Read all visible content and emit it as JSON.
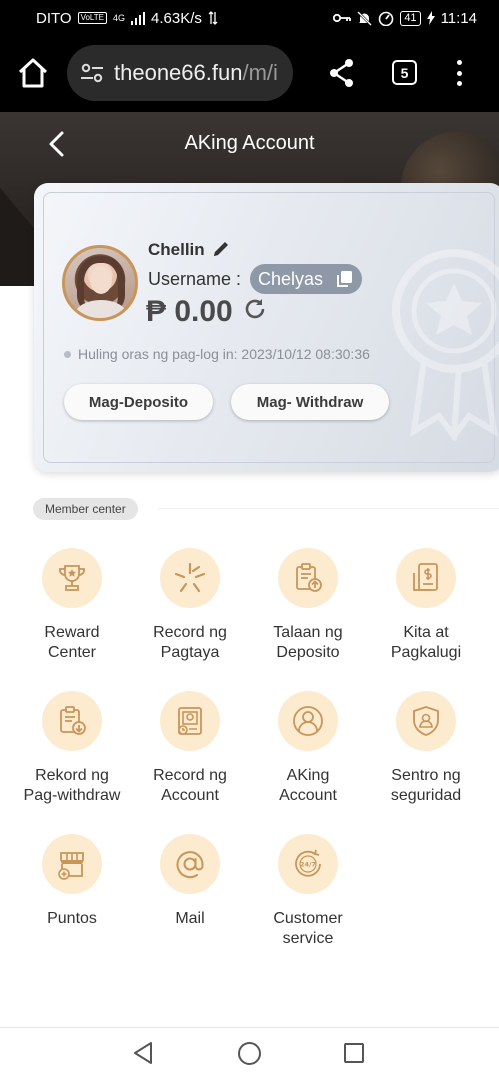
{
  "status_bar": {
    "carrier": "DITO",
    "volte": "VoLTE",
    "network": "4G",
    "speed": "4.63K/s",
    "battery": "41",
    "time": "11:14"
  },
  "browser": {
    "url_main": "theone66.fun",
    "url_rest": "/m/i",
    "tab_count": "5"
  },
  "header": {
    "title": "AKing Account"
  },
  "account": {
    "nickname": "Chellin",
    "username_label": "Username :",
    "username": "Chelyas",
    "balance": "₱ 0.00",
    "last_login": "Huling oras ng pag-log in: 2023/10/12 08:30:36",
    "deposit_button": "Mag-Deposito",
    "withdraw_button": "Mag- Withdraw"
  },
  "member_center": {
    "label": "Member center",
    "items": [
      {
        "label": "Reward\nCenter",
        "icon": "trophy-icon"
      },
      {
        "label": "Record ng\nPagtaya",
        "icon": "star-burst-icon"
      },
      {
        "label": "Talaan ng\nDeposito",
        "icon": "deposit-record-icon"
      },
      {
        "label": "Kita at\nPagkalugi",
        "icon": "profit-loss-icon"
      },
      {
        "label": "Rekord ng\nPag-withdraw",
        "icon": "withdraw-record-icon"
      },
      {
        "label": "Record ng\nAccount",
        "icon": "account-record-icon"
      },
      {
        "label": "AKing\nAccount",
        "icon": "user-icon"
      },
      {
        "label": "Sentro ng\nseguridad",
        "icon": "shield-user-icon"
      },
      {
        "label": "Puntos",
        "icon": "store-icon"
      },
      {
        "label": "Mail",
        "icon": "at-sign-icon"
      },
      {
        "label": "Customer\nservice",
        "icon": "24-7-icon"
      }
    ]
  },
  "theme": {
    "accent": "#c8955a",
    "icon_bg": "#fcebcf",
    "header_bg": "#2e2926"
  }
}
